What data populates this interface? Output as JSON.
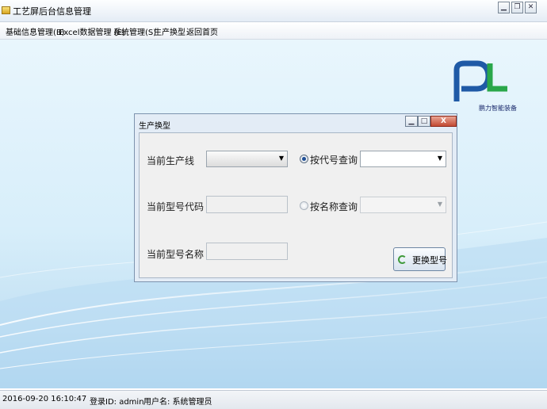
{
  "window": {
    "title": "工艺屏后台信息管理"
  },
  "menu": [
    "基础信息管理(B)",
    "Excel数据管理 (E)",
    "系统管理(S)",
    "生产换型",
    "返回首页"
  ],
  "logo": {
    "text": "鹏力智能装备",
    "color_blue": "#1f5aa6",
    "color_green": "#2aa74a"
  },
  "dialog": {
    "title": "生产换型",
    "labels": {
      "line": "当前生产线",
      "code": "当前型号代码",
      "name": "当前型号名称"
    },
    "radio_by_code": {
      "label": "按代号查询",
      "checked": true
    },
    "radio_by_name": {
      "label": "按名称查询",
      "checked": false
    },
    "fields": {
      "line_value": "",
      "code_value": "",
      "name_value": "",
      "code_query_value": "",
      "name_query_value": ""
    },
    "button": {
      "label": "更换型号",
      "icon": "refresh-icon"
    }
  },
  "status": {
    "datetime": "2016-09-20 16:10:47",
    "login": "登录ID: admin",
    "username": "用户名: 系统管理员"
  }
}
